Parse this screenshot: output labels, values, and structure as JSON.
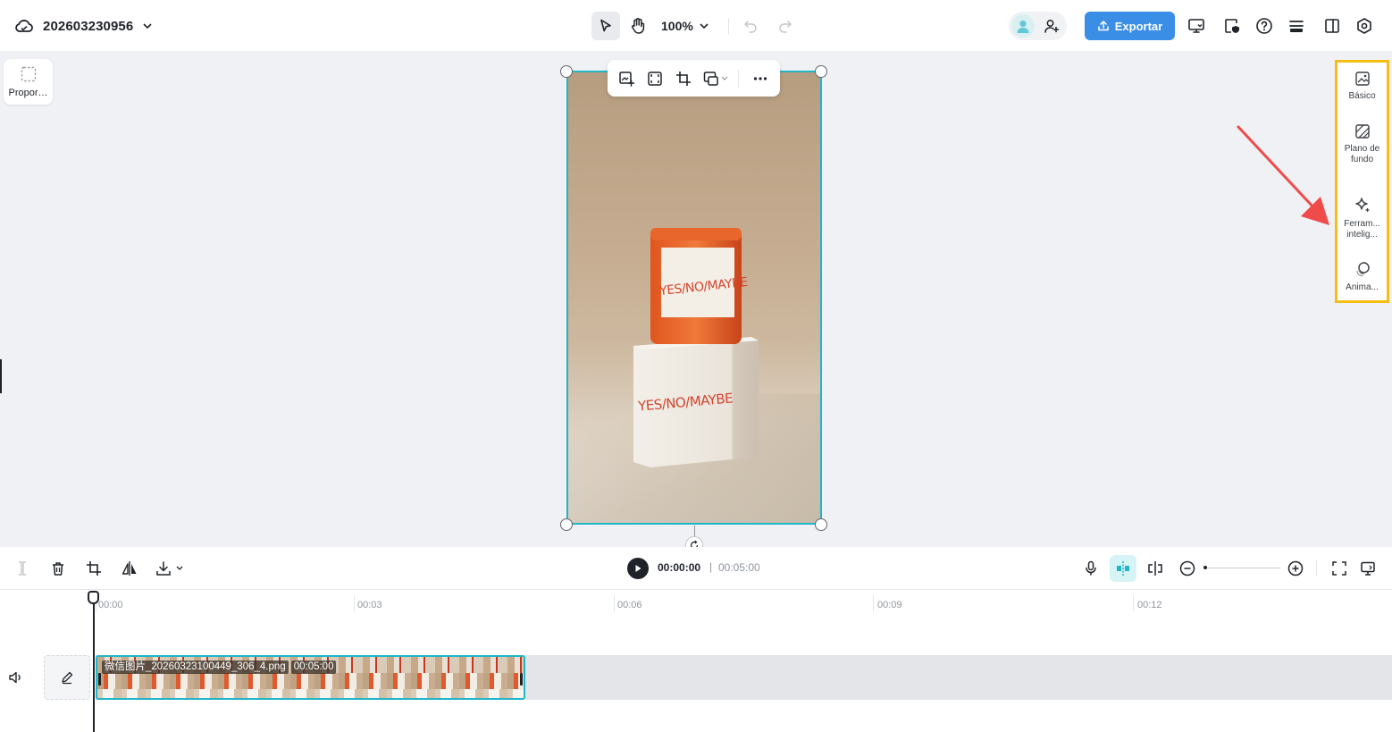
{
  "header": {
    "project_name": "202603230956",
    "zoom_level": "100%",
    "export_label": "Exportar"
  },
  "canvas": {
    "ratio_label": "Propor…",
    "product_label_text": "YES/NO/MAYBE"
  },
  "right_panel": {
    "items": [
      {
        "label": "Básico",
        "icon": "image-icon"
      },
      {
        "label": "Plano de fundo",
        "icon": "background-icon"
      },
      {
        "label": "Ferram... intelig...",
        "icon": "sparkle-icon"
      },
      {
        "label": "Anima...",
        "icon": "animation-icon"
      }
    ]
  },
  "timeline": {
    "current_time": "00:00:00",
    "separator": "|",
    "total_time": "00:05:00",
    "ruler": [
      "00:00",
      "00:03",
      "00:06",
      "00:09",
      "00:12"
    ],
    "clip": {
      "filename": "微信图片_20260323100449_306_4.png",
      "duration": "00:05:00"
    }
  },
  "colors": {
    "accent": "#3a8ee6",
    "selection": "#20b6c8",
    "highlight_box": "#f5bd16",
    "arrow": "#ef4b4b"
  }
}
